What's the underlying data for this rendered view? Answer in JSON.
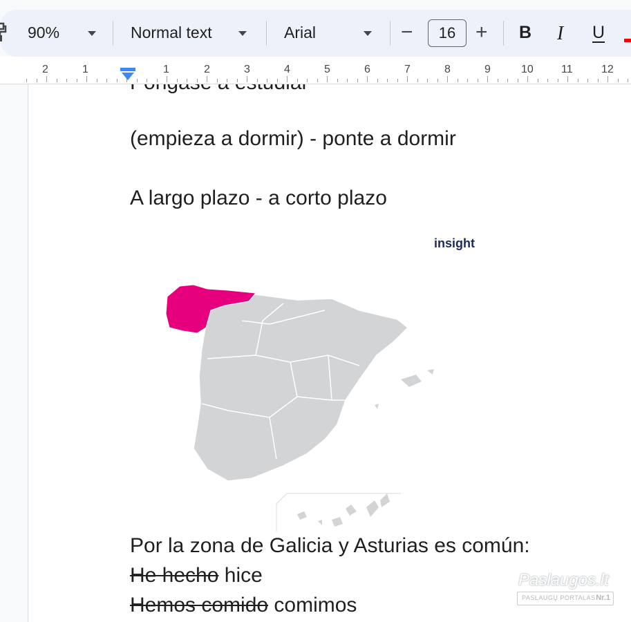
{
  "toolbar": {
    "zoom": "90%",
    "style": "Normal text",
    "font": "Arial",
    "font_size": "16",
    "minus": "−",
    "plus": "+",
    "bold": "B",
    "italic": "I",
    "underline": "U",
    "icons": [
      "paint-format-icon",
      "caret-down-icon",
      "minus-icon",
      "plus-icon",
      "bold-icon",
      "italic-icon",
      "underline-icon",
      "text-color-icon"
    ],
    "text_color_swatch": "#ff0000"
  },
  "ruler": {
    "labels": [
      "2",
      "1",
      "1",
      "2",
      "3",
      "4",
      "5",
      "6",
      "7",
      "8",
      "9",
      "10",
      "11",
      "12"
    ],
    "indent_marker_color": "#4285f4"
  },
  "document": {
    "line_cut": "Pongase a estudiar",
    "line1": "(empieza a dormir) - ponte a dormir",
    "line2": "A largo plazo - a corto plazo",
    "image": {
      "label_fragment": "insight",
      "highlight_color": "#e6007e",
      "base_color": "#d3d4d6"
    },
    "line3": "Por la zona de Galicia y Asturias es común:",
    "line4_struck": "He hecho",
    "line4_rest": " hice",
    "line5_struck": "Hemos comido",
    "line5_rest": " comimos"
  },
  "watermark": {
    "title": "Paslaugos.lt",
    "subtitle": "PASLAUGŲ PORTALAS",
    "badge": "Nr.1"
  }
}
